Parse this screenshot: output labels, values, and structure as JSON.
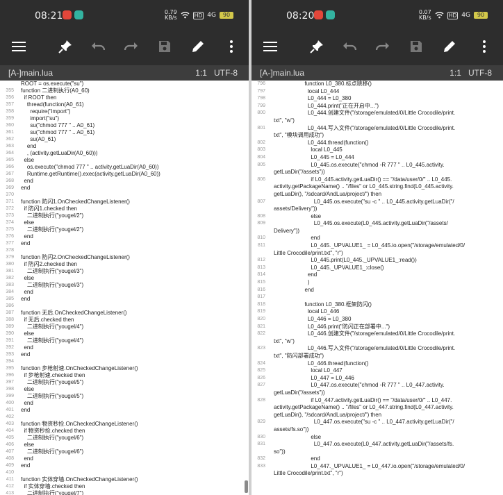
{
  "left": {
    "status": {
      "time": "08:21",
      "speed": "0.79\nKB/s",
      "hd": "HD",
      "signal": "4G",
      "battery": "90"
    },
    "tab": {
      "filename": "[A-]main.lua",
      "position": "1:1",
      "encoding": "UTF-8"
    },
    "lines": [
      [
        "",
        "ROOT = os.execute(\"su\")"
      ],
      [
        "355",
        "function 二进制执行(A0_60)"
      ],
      [
        "356",
        "  if ROOT then"
      ],
      [
        "357",
        "    thread(function(A0_61)"
      ],
      [
        "358",
        "      require(\"import\")"
      ],
      [
        "359",
        "      import(\"su\")"
      ],
      [
        "360",
        "      su(\"chmod 777 \" .. A0_61)"
      ],
      [
        "361",
        "      su(\"chmod 777 \" .. A0_61)"
      ],
      [
        "362",
        "      su(A0_61)"
      ],
      [
        "363",
        "    end"
      ],
      [
        "364",
        "    , (activity.getLuaDir(A0_60)))"
      ],
      [
        "365",
        "  else"
      ],
      [
        "366",
        "    os.execute(\"chmod 777 \" .. activity.getLuaDir(A0_60))"
      ],
      [
        "367",
        "    Runtime.getRuntime().exec(activity.getLuaDir(A0_60))"
      ],
      [
        "368",
        "  end"
      ],
      [
        "369",
        "end"
      ],
      [
        "370",
        ""
      ],
      [
        "371",
        "function 防闪1.OnCheckedChangeListener()"
      ],
      [
        "372",
        "  if 防闪1.checked then"
      ],
      [
        "373",
        "    二进制执行(\"yougel/2\")"
      ],
      [
        "374",
        "  else"
      ],
      [
        "375",
        "    二进制执行(\"yougel/2\")"
      ],
      [
        "376",
        "  end"
      ],
      [
        "377",
        "end"
      ],
      [
        "378",
        ""
      ],
      [
        "379",
        "function 防闪2.OnCheckedChangeListener()"
      ],
      [
        "380",
        "  if 防闪2.checked then"
      ],
      [
        "381",
        "    二进制执行(\"yougel/3\")"
      ],
      [
        "382",
        "  else"
      ],
      [
        "383",
        "    二进制执行(\"yougel/3\")"
      ],
      [
        "384",
        "  end"
      ],
      [
        "385",
        "end"
      ],
      [
        "386",
        ""
      ],
      [
        "387",
        "function 无后.OnCheckedChangeListener()"
      ],
      [
        "388",
        "  if 无后.checked then"
      ],
      [
        "389",
        "    二进制执行(\"yougel/4\")"
      ],
      [
        "390",
        "  else"
      ],
      [
        "391",
        "    二进制执行(\"yougel/4\")"
      ],
      [
        "392",
        "  end"
      ],
      [
        "393",
        "end"
      ],
      [
        "394",
        ""
      ],
      [
        "395",
        "function 步枪射速.OnCheckedChangeListener()"
      ],
      [
        "396",
        "  if 步枪射速.checked then"
      ],
      [
        "397",
        "    二进制执行(\"yougel/5\")"
      ],
      [
        "398",
        "  else"
      ],
      [
        "399",
        "    二进制执行(\"yougel/5\")"
      ],
      [
        "400",
        "  end"
      ],
      [
        "401",
        "end"
      ],
      [
        "402",
        ""
      ],
      [
        "403",
        "function 物资秒捡.OnCheckedChangeListener()"
      ],
      [
        "404",
        "  if 物资秒捡.checked then"
      ],
      [
        "405",
        "    二进制执行(\"yougel/6\")"
      ],
      [
        "406",
        "  else"
      ],
      [
        "407",
        "    二进制执行(\"yougel/6\")"
      ],
      [
        "408",
        "  end"
      ],
      [
        "409",
        "end"
      ],
      [
        "410",
        ""
      ],
      [
        "411",
        "function 实体穿墙.OnCheckedChangeListener()"
      ],
      [
        "412",
        "  if 实体穿墙.checked then"
      ],
      [
        "413",
        "    二进制执行(\"yougel/7\")"
      ],
      [
        "414",
        "  else"
      ],
      [
        "415",
        "    二进制执行(\"yougel/7\")"
      ],
      [
        "416",
        "  end"
      ]
    ]
  },
  "right": {
    "status": {
      "time": "08:20",
      "speed": "0.07\nKB/s",
      "hd": "HD",
      "signal": "4G",
      "battery": "90"
    },
    "tab": {
      "filename": "[A-]main.lua",
      "position": "1:1",
      "encoding": "UTF-8"
    },
    "lines": [
      [
        "796",
        "                    function L0_380.标点跳移()"
      ],
      [
        "797",
        "                      local L0_444"
      ],
      [
        "798",
        "                      L0_444 = L0_380"
      ],
      [
        "799",
        "                      L0_444.print(\"正在开启中...\")"
      ],
      [
        "800",
        "                      L0_444.创建文件(\"/storage/emulated/0/Little Crocodile/print."
      ],
      [
        "",
        "txt\", \"w\")"
      ],
      [
        "801",
        "                      L0_444.写入文件(\"/storage/emulated/0/Little Crocodile/print."
      ],
      [
        "",
        "txt\", \"模块调用成功\")"
      ],
      [
        "802",
        "                      L0_444.thread(function()"
      ],
      [
        "803",
        "                        local L0_445"
      ],
      [
        "804",
        "                        L0_445 = L0_444"
      ],
      [
        "805",
        "                        L0_445.os.execute(\"chmod -R 777 \" .. L0_445.activity."
      ],
      [
        "",
        "getLuaDir(\"/assets\"))"
      ],
      [
        "806",
        "                        if L0_445.activity.getLuaDir() == \"/data/user/0/\" .. L0_445."
      ],
      [
        "",
        "activity.getPackageName() .. \"/files\" or L0_445.string.find(L0_445.activity."
      ],
      [
        "",
        "getLuaDir(), \"/sdcard/AndLua/project/\") then"
      ],
      [
        "807",
        "                          L0_445.os.execute(\"su -c \" .. L0_445.activity.getLuaDir(\"/"
      ],
      [
        "",
        "assets/Delivery\"))"
      ],
      [
        "808",
        "                        else"
      ],
      [
        "809",
        "                          L0_445.os.execute(L0_445.activity.getLuaDir(\"/assets/"
      ],
      [
        "",
        "Delivery\"))"
      ],
      [
        "810",
        "                        end"
      ],
      [
        "811",
        "                        L0_445._UPVALUE1_ = L0_445.io.open(\"/storage/emulated/0/"
      ],
      [
        "",
        "Little Crocodile/print.txt\", \"r\")"
      ],
      [
        "812",
        "                        L0_445.print(L0_445._UPVALUE1_:read())"
      ],
      [
        "813",
        "                        L0_445._UPVALUE1_:close()"
      ],
      [
        "814",
        "                      end"
      ],
      [
        "815",
        "                      )"
      ],
      [
        "816",
        "                    end"
      ],
      [
        "817",
        ""
      ],
      [
        "818",
        "                    function L0_380.框架防闪()"
      ],
      [
        "819",
        "                      local L0_446"
      ],
      [
        "820",
        "                      L0_446 = L0_380"
      ],
      [
        "821",
        "                      L0_446.print(\"防闪正在部署中...\")"
      ],
      [
        "822",
        "                      L0_446.创建文件(\"/storage/emulated/0/Little Crocodile/print."
      ],
      [
        "",
        "txt\", \"w\")"
      ],
      [
        "823",
        "                      L0_446.写入文件(\"/storage/emulated/0/Little Crocodile/print."
      ],
      [
        "",
        "txt\", \"防闪部署成功\")"
      ],
      [
        "824",
        "                      L0_446.thread(function()"
      ],
      [
        "825",
        "                        local L0_447"
      ],
      [
        "826",
        "                        L0_447 = L0_446"
      ],
      [
        "827",
        "                        L0_447.os.execute(\"chmod -R 777 \" .. L0_447.activity."
      ],
      [
        "",
        "getLuaDir(\"/assets\"))"
      ],
      [
        "828",
        "                        if L0_447.activity.getLuaDir() == \"/data/user/0/\" .. L0_447."
      ],
      [
        "",
        "activity.getPackageName() .. \"/files\" or L0_447.string.find(L0_447.activity."
      ],
      [
        "",
        "getLuaDir(), \"/sdcard/AndLua/project/\") then"
      ],
      [
        "829",
        "                          L0_447.os.execute(\"su -c \" .. L0_447.activity.getLuaDir(\"/"
      ],
      [
        "",
        "assets/fs.so\"))"
      ],
      [
        "830",
        "                        else"
      ],
      [
        "831",
        "                          L0_447.os.execute(L0_447.activity.getLuaDir(\"/assets/fs."
      ],
      [
        "",
        "so\"))"
      ],
      [
        "832",
        "                        end"
      ],
      [
        "833",
        "                        L0_447._UPVALUE1_ = L0_447.io.open(\"/storage/emulated/0/"
      ],
      [
        "",
        "Little Crocodile/print.txt\", \"r\")"
      ]
    ]
  }
}
